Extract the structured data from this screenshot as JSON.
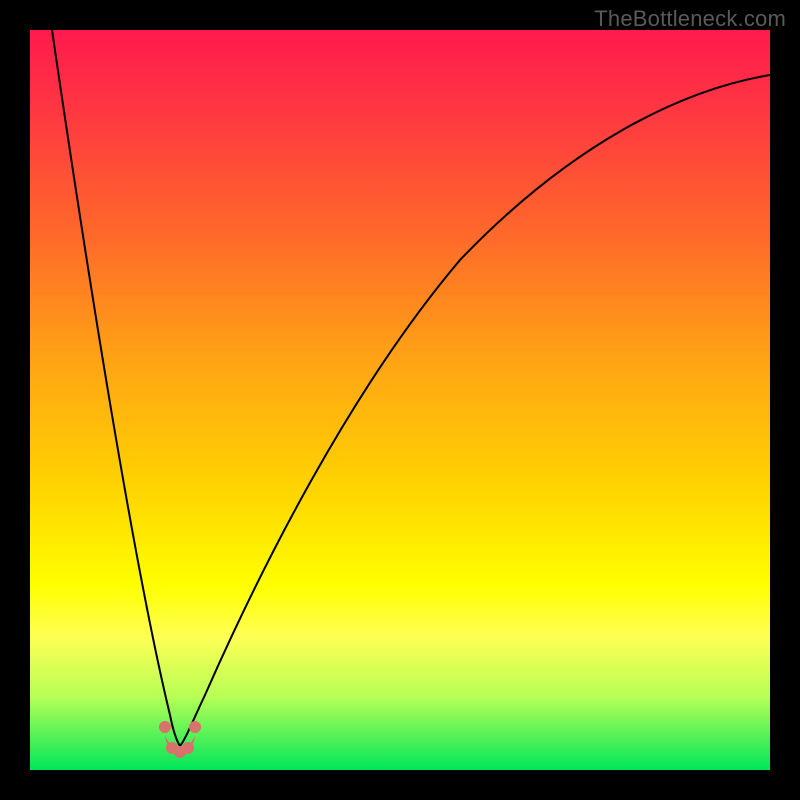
{
  "watermark": "TheBottleneck.com",
  "chart_data": {
    "type": "line",
    "title": "",
    "xlabel": "",
    "ylabel": "",
    "xlim": [
      0,
      100
    ],
    "ylim": [
      0,
      100
    ],
    "grid": false,
    "legend": false,
    "series": [
      {
        "name": "left-arm",
        "x": [
          3,
          4,
          5,
          6,
          7,
          8,
          9,
          10,
          11,
          12,
          13,
          14,
          15,
          16,
          17,
          18,
          19
        ],
        "values": [
          99,
          94,
          88,
          82,
          76,
          70,
          63,
          57,
          50,
          43,
          36,
          29,
          22,
          15,
          10,
          5,
          2
        ]
      },
      {
        "name": "right-arm",
        "x": [
          22,
          23,
          24,
          26,
          28,
          30,
          33,
          36,
          40,
          45,
          50,
          55,
          60,
          66,
          72,
          78,
          85,
          92,
          100
        ],
        "values": [
          2,
          5,
          9,
          15,
          22,
          29,
          36,
          43,
          50,
          57,
          63,
          68,
          73,
          77,
          81,
          84,
          87,
          89,
          91
        ]
      }
    ],
    "markers": {
      "name": "highlight-dots",
      "x": [
        18.0,
        19.0,
        19.5,
        20.5,
        21.0,
        22.0
      ],
      "values": [
        5.0,
        2.5,
        1.5,
        1.5,
        2.5,
        5.0
      ]
    },
    "gradient_meaning": "background gradient from red (top / high bottleneck) to green (bottom / no bottleneck)"
  }
}
